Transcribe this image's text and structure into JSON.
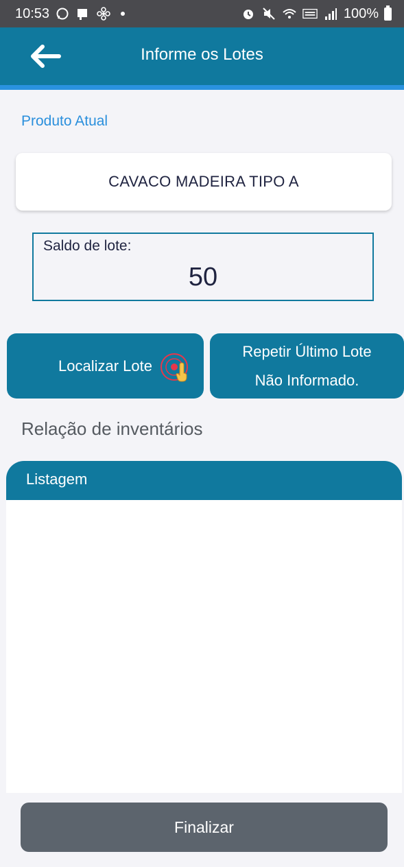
{
  "status_bar": {
    "time": "10:53",
    "battery": "100%",
    "left_icons": [
      "whatsapp-icon",
      "notification-app-icon",
      "fan-icon"
    ],
    "right_icons": [
      "alarm-icon",
      "mute-icon",
      "wifi-icon",
      "volte-icon",
      "signal-icon",
      "battery-icon"
    ]
  },
  "app_bar": {
    "title": "Informe os Lotes",
    "back_icon": "arrow-left-icon"
  },
  "product": {
    "section_label": "Produto Atual",
    "name": "CAVACO MADEIRA TIPO A"
  },
  "saldo": {
    "label": "Saldo de lote:",
    "value": "50"
  },
  "actions": {
    "localizar_label": "Localizar Lote",
    "repetir_line1": "Repetir Último Lote",
    "repetir_line2": "Não Informado."
  },
  "inventory": {
    "title": "Relação de inventários",
    "list_header": "Listagem",
    "items": []
  },
  "footer": {
    "finalizar_label": "Finalizar"
  },
  "colors": {
    "primary": "#10799e",
    "accent": "#2a92df",
    "footer_button": "#5c646d",
    "status_bar": "#4a4a4e"
  }
}
